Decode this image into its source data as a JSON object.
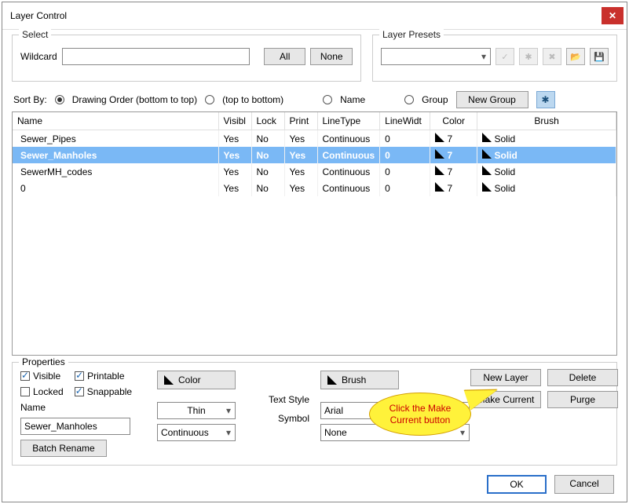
{
  "window": {
    "title": "Layer Control"
  },
  "select": {
    "legend": "Select",
    "wildcard_label": "Wildcard",
    "all": "All",
    "none": "None"
  },
  "presets": {
    "legend": "Layer Presets",
    "value": ""
  },
  "sortby": {
    "label": "Sort By:",
    "r1": "Drawing Order (bottom to top)",
    "r2": "(top to bottom)",
    "r3": "Name",
    "r4": "Group",
    "newgroup": "New Group"
  },
  "columns": [
    "Name",
    "Visibl",
    "Lock",
    "Print",
    "LineType",
    "LineWidt",
    "Color",
    "Brush"
  ],
  "rows": [
    {
      "name": "Sewer_Pipes",
      "vis": "Yes",
      "lock": "No",
      "print": "Yes",
      "lt": "Continuous",
      "lw": "0",
      "color": "7",
      "brush": "Solid",
      "sel": false
    },
    {
      "name": "Sewer_Manholes",
      "vis": "Yes",
      "lock": "No",
      "print": "Yes",
      "lt": "Continuous",
      "lw": "0",
      "color": "7",
      "brush": "Solid",
      "sel": true
    },
    {
      "name": "SewerMH_codes",
      "vis": "Yes",
      "lock": "No",
      "print": "Yes",
      "lt": "Continuous",
      "lw": "0",
      "color": "7",
      "brush": "Solid",
      "sel": false
    },
    {
      "name": "0",
      "vis": "Yes",
      "lock": "No",
      "print": "Yes",
      "lt": "Continuous",
      "lw": "0",
      "color": "7",
      "brush": "Solid",
      "sel": false
    }
  ],
  "props": {
    "legend": "Properties",
    "visible": "Visible",
    "printable": "Printable",
    "locked": "Locked",
    "snappable": "Snappable",
    "name_label": "Name",
    "name_value": "Sewer_Manholes",
    "batch": "Batch Rename",
    "color": "Color",
    "brush": "Brush",
    "thin": "Thin",
    "continuous": "Continuous",
    "textstyle_label": "Text Style",
    "textstyle": "Arial",
    "symbol_label": "Symbol",
    "symbol": "None"
  },
  "buttons": {
    "newlayer": "New Layer",
    "delete": "Delete",
    "makecurrent": "Make Current",
    "purge": "Purge",
    "ok": "OK",
    "cancel": "Cancel"
  },
  "callout": "Click the Make Current button"
}
